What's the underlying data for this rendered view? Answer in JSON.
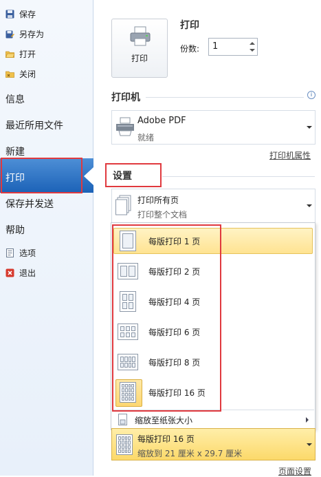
{
  "nav": {
    "save": "保存",
    "save_as": "另存为",
    "open": "打开",
    "close": "关闭",
    "info": "信息",
    "recent": "最近所用文件",
    "new": "新建",
    "print": "打印",
    "save_send": "保存并发送",
    "help": "帮助",
    "options": "选项",
    "exit": "退出"
  },
  "print_section": {
    "title": "打印",
    "button_label": "打印",
    "copies_label": "份数:",
    "copies_value": "1"
  },
  "printer": {
    "title": "打印机",
    "name": "Adobe PDF",
    "status": "就绪",
    "properties_link": "打印机属性"
  },
  "settings": {
    "title": "设置",
    "range_main": "打印所有页",
    "range_sub": "打印整个文档",
    "layout_options": [
      "每版打印 1 页",
      "每版打印 2 页",
      "每版打印 4 页",
      "每版打印 6 页",
      "每版打印 8 页",
      "每版打印 16 页"
    ],
    "scale_to_paper": "缩放至纸张大小",
    "selected_layout_main": "每版打印 16 页",
    "selected_layout_sub": "缩放到 21 厘米 x 29.7 厘米",
    "page_setup_link": "页面设置"
  },
  "colors": {
    "nav_selected": "#1c62b7",
    "highlight": "#ffe392",
    "annotation_red": "#e0393e"
  }
}
